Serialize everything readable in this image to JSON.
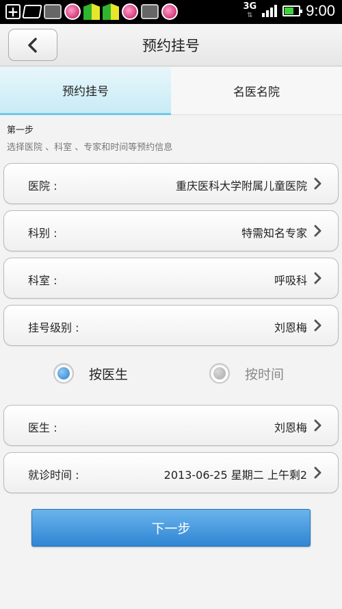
{
  "statusbar": {
    "network": "3G",
    "time": "9:00",
    "signal_level": 4,
    "signal_max": 4,
    "battery_level": 0.6,
    "icons": [
      "add-icon",
      "notes-icon",
      "game-icon",
      "music-icon",
      "flag-icon",
      "flag-icon",
      "music-icon",
      "game-icon",
      "music-icon"
    ]
  },
  "header": {
    "title": "预约挂号",
    "back_icon": "chevron-left-icon"
  },
  "tabs": [
    {
      "label": "预约挂号",
      "active": true
    },
    {
      "label": "名医名院",
      "active": false
    }
  ],
  "step": {
    "title": "第一步",
    "description": "选择医院 、科室 、专家和时间等预约信息"
  },
  "fields": {
    "hospital": {
      "label": "医院 :",
      "value": "重庆医科大学附属儿童医院"
    },
    "category": {
      "label": "科别 :",
      "value": "特需知名专家"
    },
    "department": {
      "label": "科室 :",
      "value": "呼吸科"
    },
    "level": {
      "label": "挂号级别 :",
      "value": "刘恩梅"
    },
    "doctor": {
      "label": "医生 :",
      "value": "刘恩梅"
    },
    "visit_time": {
      "label": "就诊时间 :",
      "value": "2013-06-25 星期二 上午剩2"
    }
  },
  "mode": {
    "by_doctor": "按医生",
    "by_time": "按时间",
    "selected": "by_doctor"
  },
  "next_button": "下一步",
  "colors": {
    "accent": "#3a8fd8",
    "tab_active": "#c9ebf6",
    "tab_indicator": "#6bc9ea"
  }
}
